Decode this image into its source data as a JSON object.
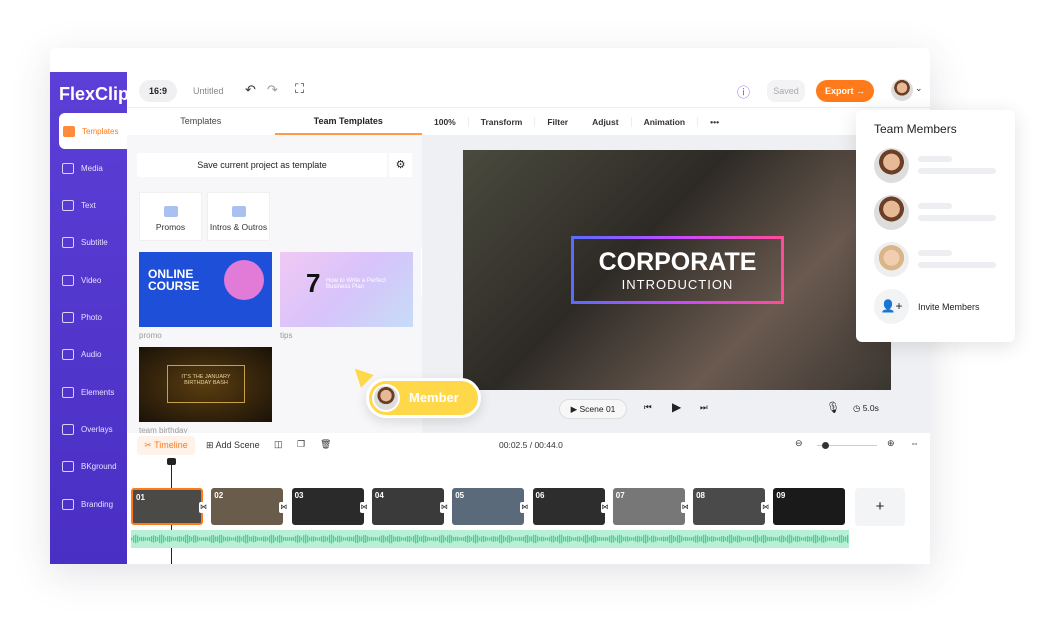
{
  "app": {
    "logo": "FlexClip",
    "ratio": "16:9",
    "title": "Untitled",
    "saved": "Saved",
    "export": "Export →"
  },
  "sidebar": {
    "items": [
      {
        "label": "Templates"
      },
      {
        "label": "Media"
      },
      {
        "label": "Text"
      },
      {
        "label": "Subtitle"
      },
      {
        "label": "Video"
      },
      {
        "label": "Photo"
      },
      {
        "label": "Audio"
      },
      {
        "label": "Elements"
      },
      {
        "label": "Overlays"
      },
      {
        "label": "BKground"
      },
      {
        "label": "Branding"
      }
    ]
  },
  "panel": {
    "tabs": [
      "Templates",
      "Team Templates"
    ],
    "save_template": "Save current project as template",
    "folders": [
      "Promos",
      "Intros & Outros"
    ],
    "templates": [
      {
        "caption": "promo",
        "text": "ONLINE COURSE"
      },
      {
        "caption": "tips",
        "text": "How to Write a Perfect Business Plan",
        "number": "7"
      },
      {
        "caption": "team birthday",
        "text": "IT'S THE JANUARY BIRTHDAY BASH"
      }
    ]
  },
  "toolbar": {
    "zoom": "100%",
    "items": [
      "Transform",
      "Filter",
      "Adjust",
      "Animation",
      "•••"
    ]
  },
  "preview": {
    "title": "CORPORATE",
    "subtitle": "INTRODUCTION",
    "scene": "Scene 01",
    "duration": "5.0s"
  },
  "timeline": {
    "label": "Timeline",
    "add_scene": "Add Scene",
    "time": "00:02.5 / 00:44.0",
    "clips": [
      "01",
      "02",
      "03",
      "04",
      "05",
      "06",
      "07",
      "08",
      "09"
    ],
    "add": "+"
  },
  "team": {
    "title": "Team Members",
    "invite": "Invite Members"
  },
  "member_tag": "Member",
  "colors": {
    "accent": "#ff7a1a",
    "sidebar": "#5b3fd6",
    "tag": "#ffd84a"
  }
}
